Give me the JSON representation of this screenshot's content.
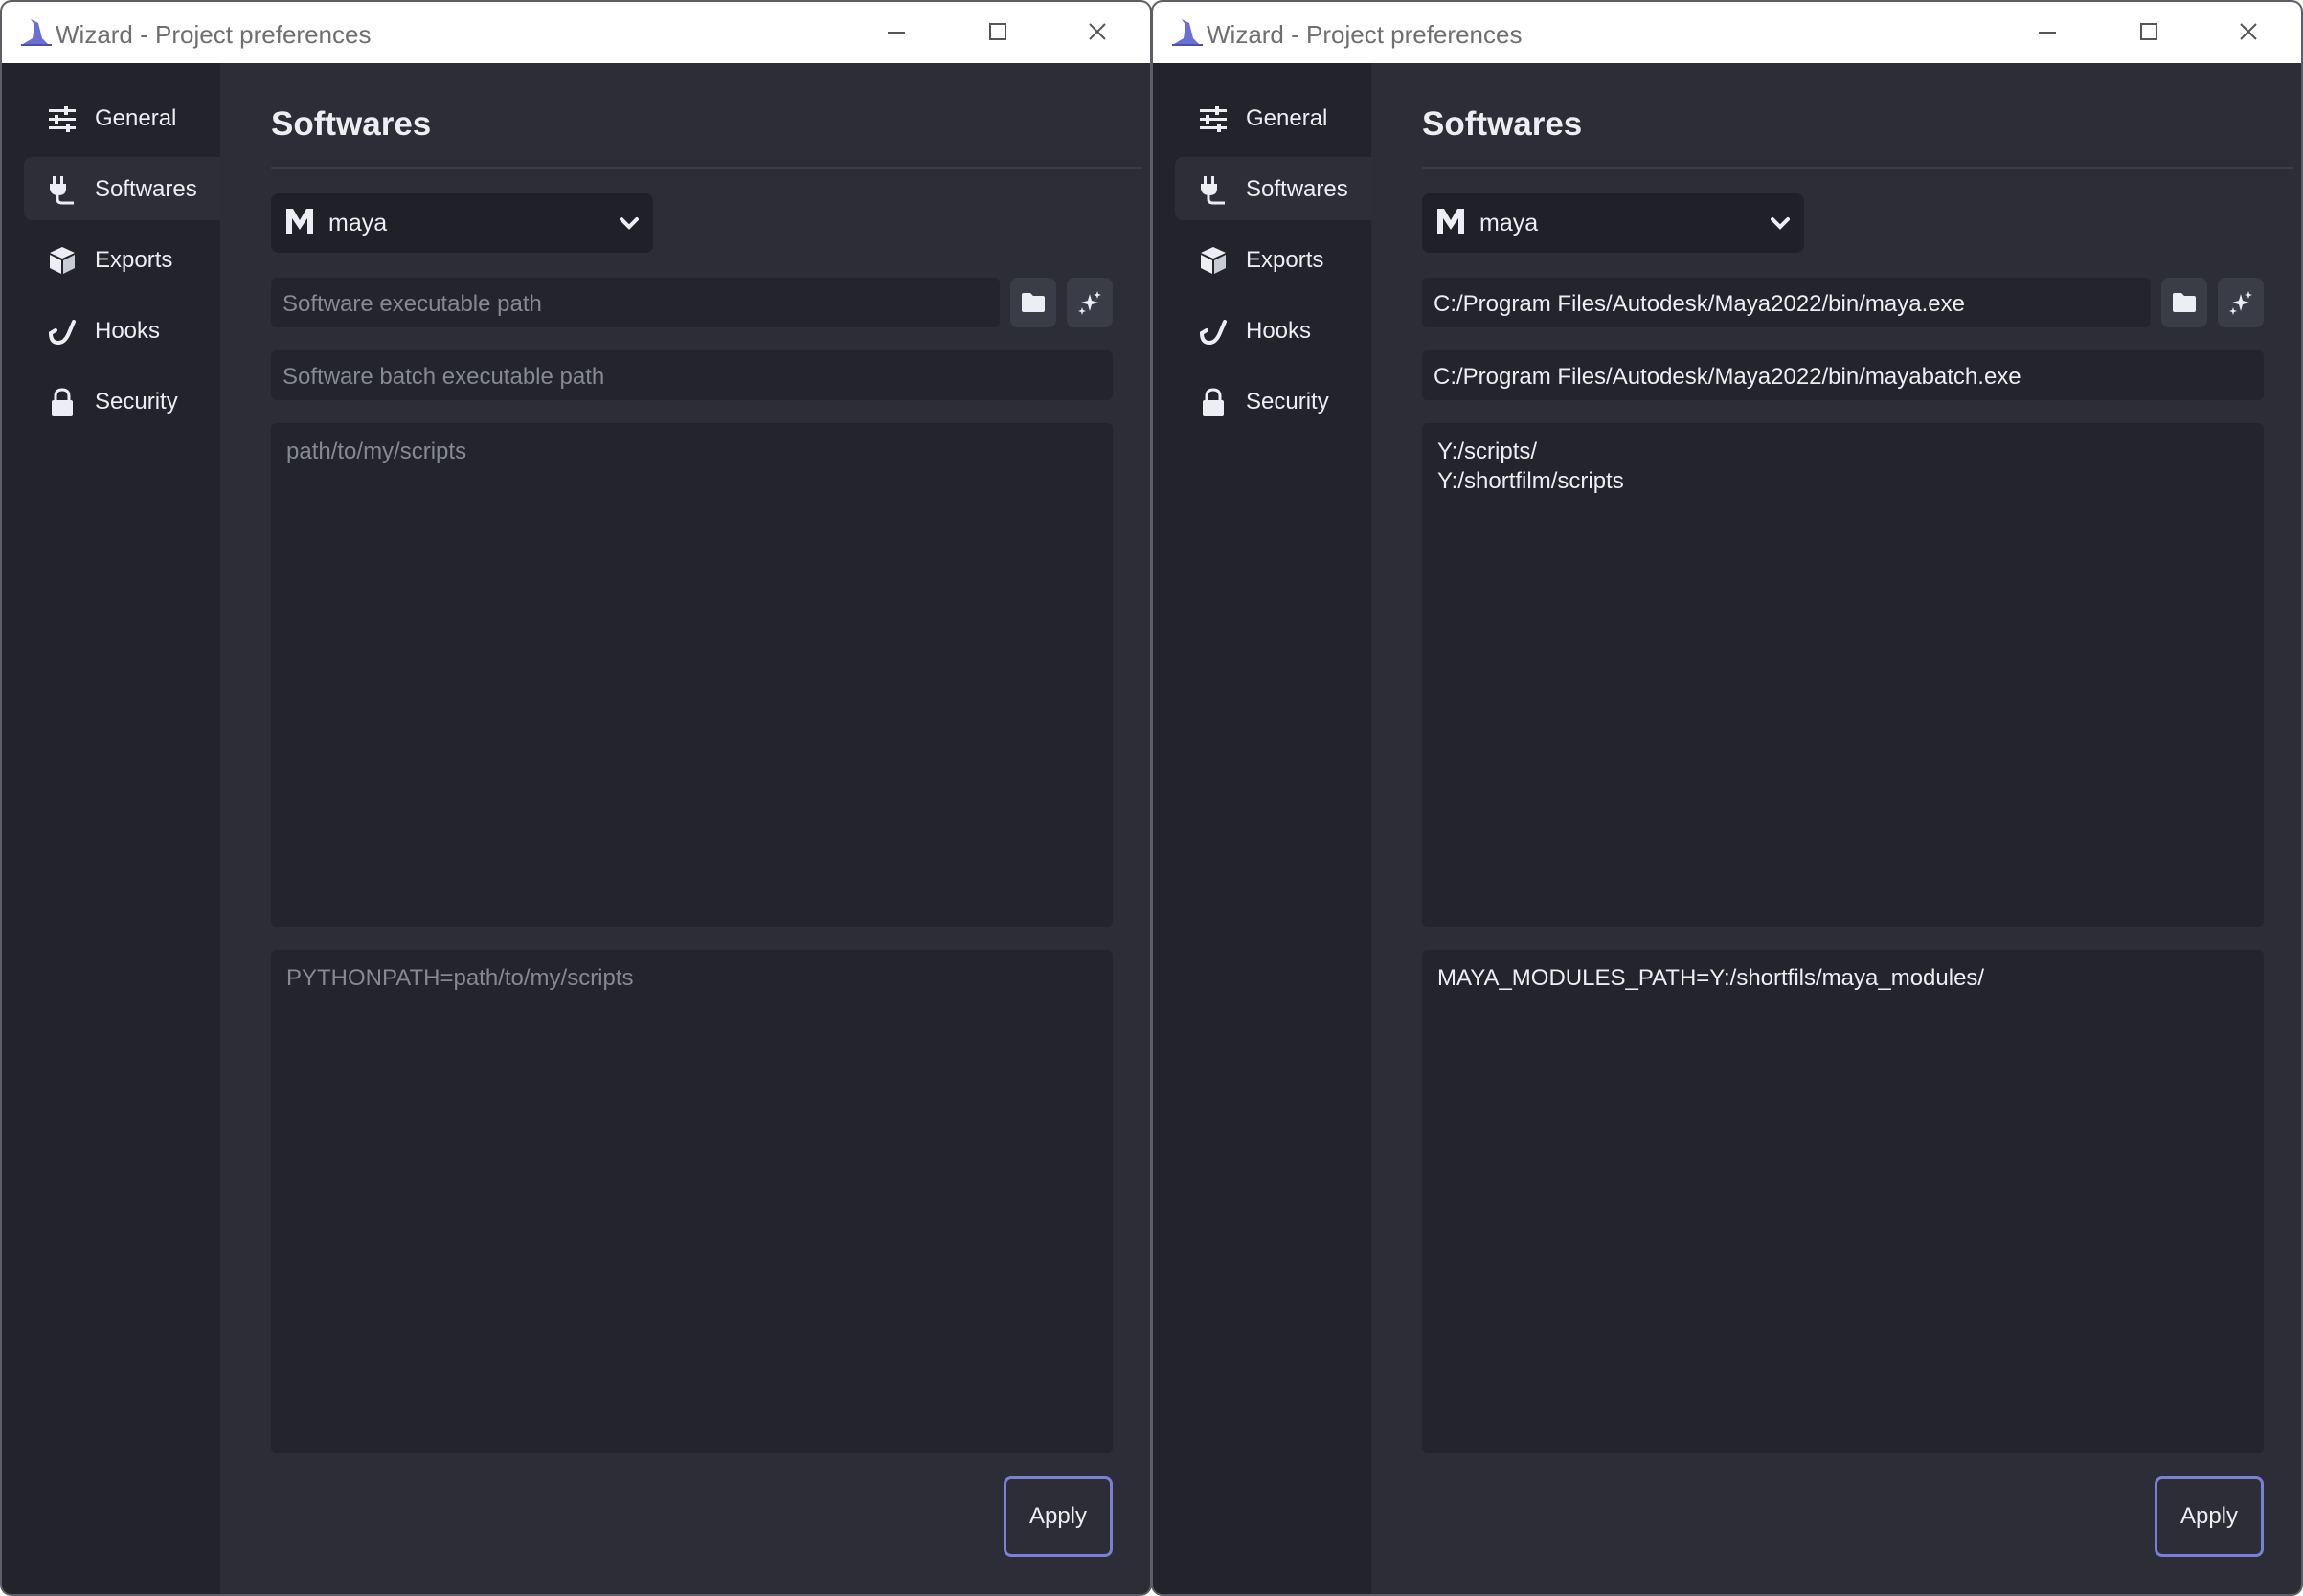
{
  "windows": [
    {
      "title": "Wizard - Project preferences",
      "sidebar": {
        "items": [
          {
            "label": "General",
            "icon": "sliders-icon",
            "active": false
          },
          {
            "label": "Softwares",
            "icon": "plug-icon",
            "active": true
          },
          {
            "label": "Exports",
            "icon": "box-icon",
            "active": false
          },
          {
            "label": "Hooks",
            "icon": "hook-icon",
            "active": false
          },
          {
            "label": "Security",
            "icon": "lock-icon",
            "active": false
          }
        ]
      },
      "main": {
        "title": "Softwares",
        "software_select": {
          "value": "maya",
          "icon": "maya-logo-icon"
        },
        "exe_path": {
          "value": "",
          "placeholder": "Software executable path"
        },
        "batch_path": {
          "value": "",
          "placeholder": "Software batch executable path"
        },
        "scripts_paths": {
          "lines": [],
          "placeholder": "path/to/my/scripts"
        },
        "env": {
          "lines": [],
          "placeholder": "PYTHONPATH=path/to/my/scripts"
        },
        "apply_label": "Apply"
      }
    },
    {
      "title": "Wizard - Project preferences",
      "sidebar": {
        "items": [
          {
            "label": "General",
            "icon": "sliders-icon",
            "active": false
          },
          {
            "label": "Softwares",
            "icon": "plug-icon",
            "active": true
          },
          {
            "label": "Exports",
            "icon": "box-icon",
            "active": false
          },
          {
            "label": "Hooks",
            "icon": "hook-icon",
            "active": false
          },
          {
            "label": "Security",
            "icon": "lock-icon",
            "active": false
          }
        ]
      },
      "main": {
        "title": "Softwares",
        "software_select": {
          "value": "maya",
          "icon": "maya-logo-icon"
        },
        "exe_path": {
          "value": "C:/Program Files/Autodesk/Maya2022/bin/maya.exe",
          "placeholder": "Software executable path"
        },
        "batch_path": {
          "value": "C:/Program Files/Autodesk/Maya2022/bin/mayabatch.exe",
          "placeholder": "Software batch executable path"
        },
        "scripts_paths": {
          "lines": [
            "Y:/scripts/",
            "Y:/shortfilm/scripts"
          ],
          "placeholder": "path/to/my/scripts"
        },
        "env": {
          "lines": [
            "MAYA_MODULES_PATH=Y:/shortfils/maya_modules/"
          ],
          "placeholder": "PYTHONPATH=path/to/my/scripts"
        },
        "apply_label": "Apply"
      }
    }
  ],
  "colors": {
    "accent": "#7b7fd6",
    "window_bg": "#2c2d36",
    "sidebar_bg": "#22232b",
    "input_bg": "#23242d",
    "text": "#eceef3",
    "placeholder": "#868894"
  }
}
